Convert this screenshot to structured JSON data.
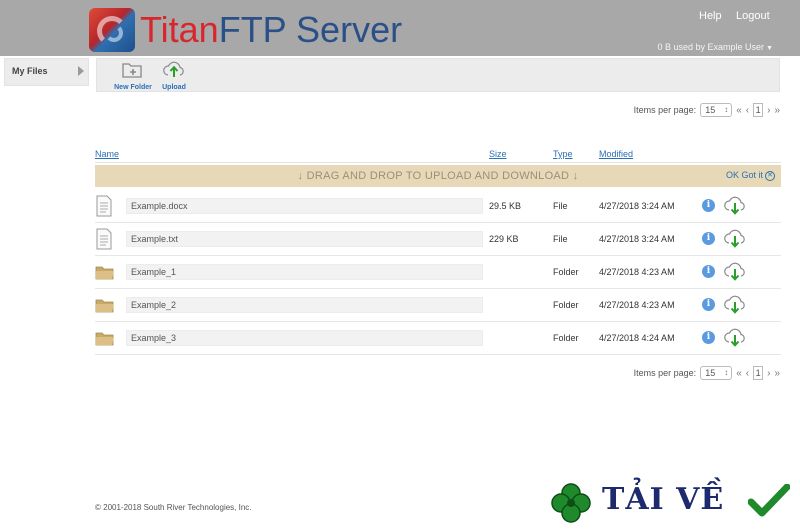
{
  "header": {
    "brand_part1": "Titan",
    "brand_part2": "FTP Server",
    "help": "Help",
    "logout": "Logout",
    "usage": "0 B used by  Example User"
  },
  "sidebar": {
    "items": [
      {
        "label": "My Files"
      }
    ]
  },
  "toolbar": {
    "new_folder": "New Folder",
    "upload": "Upload"
  },
  "pager": {
    "label": "Items per page:",
    "per_page": "15",
    "first": "«",
    "prev": "‹",
    "page": "1",
    "next": "›",
    "last": "»"
  },
  "columns": {
    "name": "Name",
    "size": "Size",
    "type": "Type",
    "modified": "Modified"
  },
  "dropbar": {
    "text": "↓ DRAG AND DROP TO UPLOAD AND DOWNLOAD ↓",
    "ok": "OK Got it"
  },
  "files": [
    {
      "name": "Example.docx",
      "size": "29.5 KB",
      "type": "File",
      "modified": "4/27/2018 3:24 AM",
      "icon": "document-icon"
    },
    {
      "name": "Example.txt",
      "size": "229 KB",
      "type": "File",
      "modified": "4/27/2018 3:24 AM",
      "icon": "document-icon"
    },
    {
      "name": "Example_1",
      "size": "",
      "type": "Folder",
      "modified": "4/27/2018 4:23 AM",
      "icon": "folder-icon"
    },
    {
      "name": "Example_2",
      "size": "",
      "type": "Folder",
      "modified": "4/27/2018 4:23 AM",
      "icon": "folder-icon"
    },
    {
      "name": "Example_3",
      "size": "",
      "type": "Folder",
      "modified": "4/27/2018 4:24 AM",
      "icon": "folder-icon"
    }
  ],
  "footer": {
    "copyright": "© 2001-2018 South River Technologies, Inc."
  },
  "watermark": {
    "text": "TẢI VỀ"
  },
  "colors": {
    "accent": "#2b6fb5",
    "brand_red": "#d8262d",
    "brand_blue": "#2b4f87",
    "dropbar": "#e7d9b8"
  }
}
